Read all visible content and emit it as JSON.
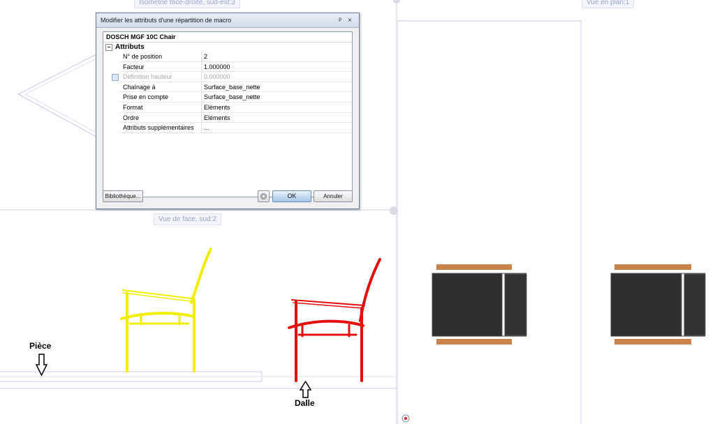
{
  "viewports": {
    "isometric_label": "Isométrie face-droite, sud-est:3",
    "front_label": "Vue de face, sud:2",
    "plan_label": "Vue en plan:1"
  },
  "dialog": {
    "title": "Modifier les attributs d'une répartition de macro",
    "pin_glyph": "ᵖ",
    "close_glyph": "×",
    "object_name": "DOSCH MGF 10C Chair",
    "section_label": "Attributs",
    "section_expander": "−",
    "rows": [
      {
        "name": "N° de position",
        "value": "2"
      },
      {
        "name": "Facteur",
        "value": "1.000000"
      },
      {
        "name": "Définition hauteur",
        "value": "0.000000"
      },
      {
        "name": "Chaînage à",
        "value": "Surface_base_nette"
      },
      {
        "name": "Prise en compte",
        "value": "Surface_base_nette"
      },
      {
        "name": "Format",
        "value": "Eléments"
      },
      {
        "name": "Ordre",
        "value": "Eléments"
      },
      {
        "name": "Attributs supplémentaires",
        "value": "..."
      }
    ],
    "library_button": "Bibliothèque...",
    "ok_button": "OK",
    "cancel_button": "Annuler"
  },
  "annotations": {
    "piece": "Pièce",
    "dalle": "Dalle"
  },
  "colors": {
    "yellow_chair": "#f2ee00",
    "red_chair": "#e50f0f",
    "table_top": "#2f2f2f",
    "table_wood": "#c8844a"
  }
}
